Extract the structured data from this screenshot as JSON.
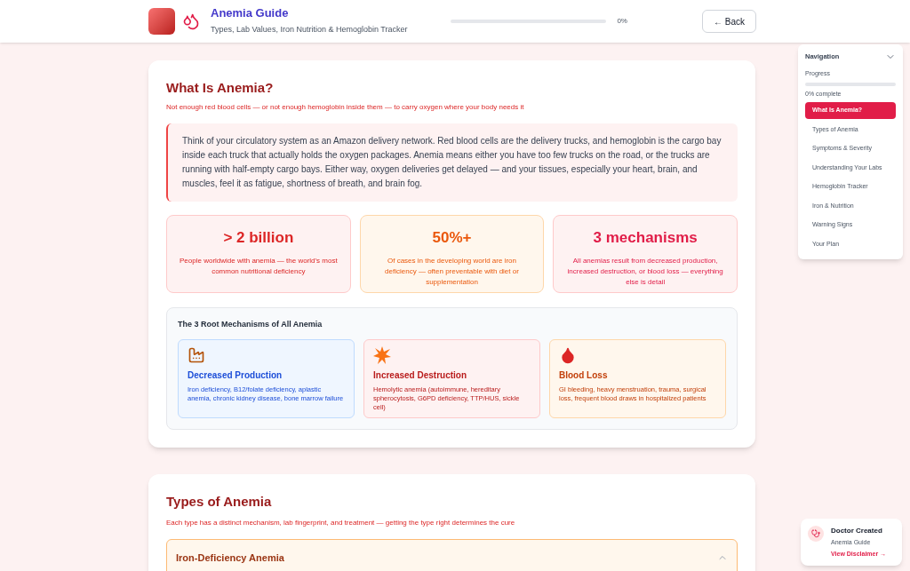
{
  "header": {
    "title": "Anemia Guide",
    "subtitle": "Types, Lab Values, Iron Nutrition & Hemoglobin Tracker",
    "progress": {
      "level": 0,
      "reading": "0%"
    },
    "back_button": "← Back"
  },
  "navigation": {
    "title": "Navigation",
    "expanded": true,
    "progress_label": "Progress",
    "progress": {
      "level": 0
    },
    "progress_text": "0% complete",
    "items": [
      {
        "label": "What Is Anemia?",
        "selected": true
      },
      {
        "label": "Types of Anemia",
        "selected": false
      },
      {
        "label": "Symptoms & Severity",
        "selected": false
      },
      {
        "label": "Understanding Your Labs",
        "selected": false
      },
      {
        "label": "Hemoglobin Tracker",
        "selected": false
      },
      {
        "label": "Iron & Nutrition",
        "selected": false
      },
      {
        "label": "Warning Signs",
        "selected": false
      },
      {
        "label": "Your Plan",
        "selected": false
      }
    ]
  },
  "section_1": {
    "title": "What Is Anemia?",
    "subtitle": "Not enough red blood cells — or not enough hemoglobin inside them — to carry oxygen where your body needs it",
    "analogy": "Think of your circulatory system as an Amazon delivery network. Red blood cells are the delivery trucks, and hemoglobin is the cargo bay inside each truck that actually holds the oxygen packages. Anemia means either you have too few trucks on the road, or the trucks are running with half-empty cargo bays. Either way, oxygen deliveries get delayed — and your tissues, especially your heart, brain, and muscles, feel it as fatigue, shortness of breath, and brain fog.",
    "stats": [
      {
        "value": "> 2 billion",
        "text": "People worldwide with anemia — the world's most common nutritional deficiency",
        "color": "#dc2626"
      },
      {
        "value": "50%+",
        "text": "Of cases in the developing world are iron deficiency — often preventable with diet or supplementation",
        "color": "#ea580c"
      },
      {
        "value": "3 mechanisms",
        "text": "All anemias result from decreased production, increased destruction, or blood loss — everything else is detail",
        "color": "#e11d48"
      }
    ],
    "mechanisms_title": "The 3 Root Mechanisms of All Anemia",
    "mechanisms": [
      {
        "kind": "factory",
        "title": "Decreased Production",
        "text": "Iron deficiency, B12/folate deficiency, aplastic anemia, chronic kidney disease, bone marrow failure",
        "color": "#1d4ed8"
      },
      {
        "kind": "burst",
        "title": "Increased Destruction",
        "text": "Hemolytic anemia (autoimmune, hereditary spherocytosis, G6PD deficiency, TTP/HUS, sickle cell)",
        "color": "#b91c1c"
      },
      {
        "kind": "drop",
        "title": "Blood Loss",
        "text": "GI bleeding, heavy menstruation, trauma, surgical loss, frequent blood draws in hospitalized patients",
        "color": "#c2410c"
      }
    ]
  },
  "section_2": {
    "title": "Types of Anemia",
    "subtitle": "Each type has a distinct mechanism, lab fingerprint, and treatment — getting the type right determines the cure",
    "accordion": [
      {
        "title": "Iron-Deficiency Anemia",
        "expanded": true
      }
    ]
  },
  "doctor_badge": {
    "title": "Doctor Created",
    "subtitle": "Anemia Guide",
    "link": "View Disclaimer →"
  }
}
